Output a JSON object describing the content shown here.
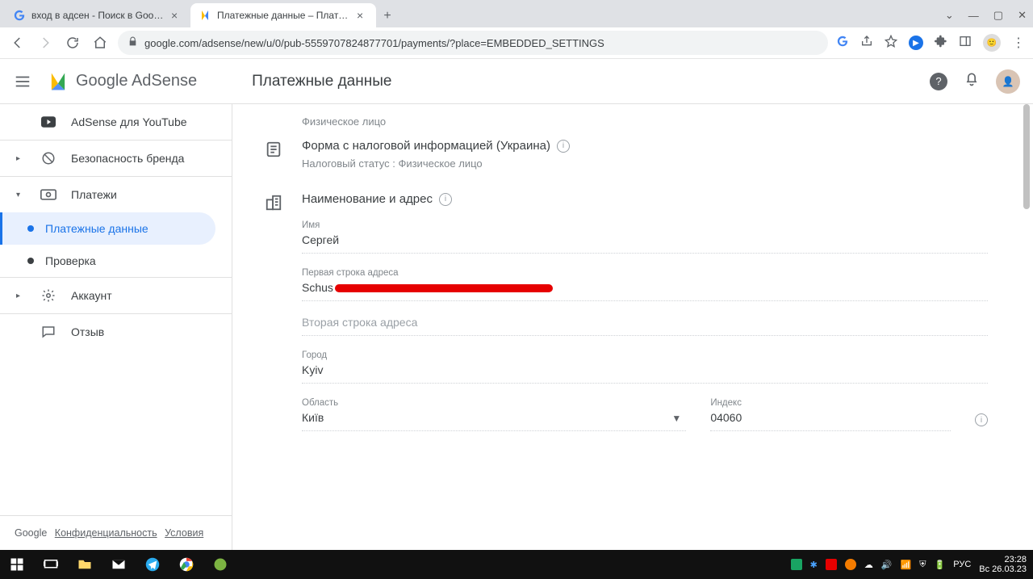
{
  "browser": {
    "tabs": [
      {
        "title": "вход в адсен - Поиск в Google"
      },
      {
        "title": "Платежные данные – Платежи"
      }
    ],
    "url": "google.com/adsense/new/u/0/pub-5559707824877701/payments/?place=EMBEDDED_SETTINGS"
  },
  "header": {
    "product": "Google AdSense",
    "pageTitle": "Платежные данные"
  },
  "sidebar": {
    "youtube": "AdSense для YouTube",
    "brandSafety": "Безопасность бренда",
    "payments": "Платежи",
    "paymentsInfo": "Платежные данные",
    "verification": "Проверка",
    "account": "Аккаунт",
    "feedback": "Отзыв",
    "footer": {
      "google": "Google",
      "privacy": "Конфиденциальность",
      "terms": "Условия"
    }
  },
  "content": {
    "accountTypeValue": "Физическое лицо",
    "taxForm": {
      "title": "Форма с налоговой информацией (Украина)",
      "statusLabel": "Налоговый статус",
      "statusValue": "Физическое лицо"
    },
    "nameAddress": {
      "title": "Наименование и адрес",
      "nameLabel": "Имя",
      "nameValue": "Сергей",
      "addr1Label": "Первая строка адреса",
      "addr1Prefix": "Schus",
      "addr2Placeholder": "Вторая строка адреса",
      "cityLabel": "Город",
      "cityValue": "Kyiv",
      "regionLabel": "Область",
      "regionValue": "Київ",
      "zipLabel": "Индекс",
      "zipValue": "04060"
    }
  },
  "taskbar": {
    "lang": "РУС",
    "time": "23:28",
    "date": "Вс 26.03.23"
  }
}
